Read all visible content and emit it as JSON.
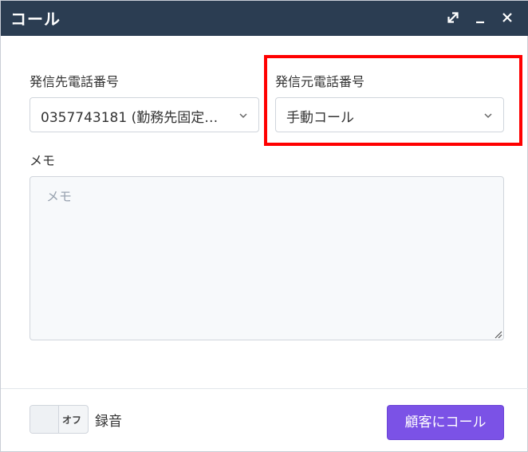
{
  "window": {
    "title": "コール",
    "controls": {
      "expand_icon": "expand-icon",
      "minimize_icon": "minimize-icon",
      "close_icon": "close-icon"
    }
  },
  "form": {
    "destination": {
      "label": "発信先電話番号",
      "value": "0357743181 (勤務先固定…"
    },
    "source": {
      "label": "発信元電話番号",
      "value": "手動コール"
    },
    "memo": {
      "label": "メモ",
      "placeholder": "メモ",
      "value": ""
    }
  },
  "footer": {
    "recording_toggle": {
      "state_text": "オフ",
      "label": "録音"
    },
    "call_button_label": "顧客にコール"
  },
  "colors": {
    "titlebar": "#2b3d52",
    "primary_button": "#7b52e6",
    "highlight": "#ff0000"
  }
}
